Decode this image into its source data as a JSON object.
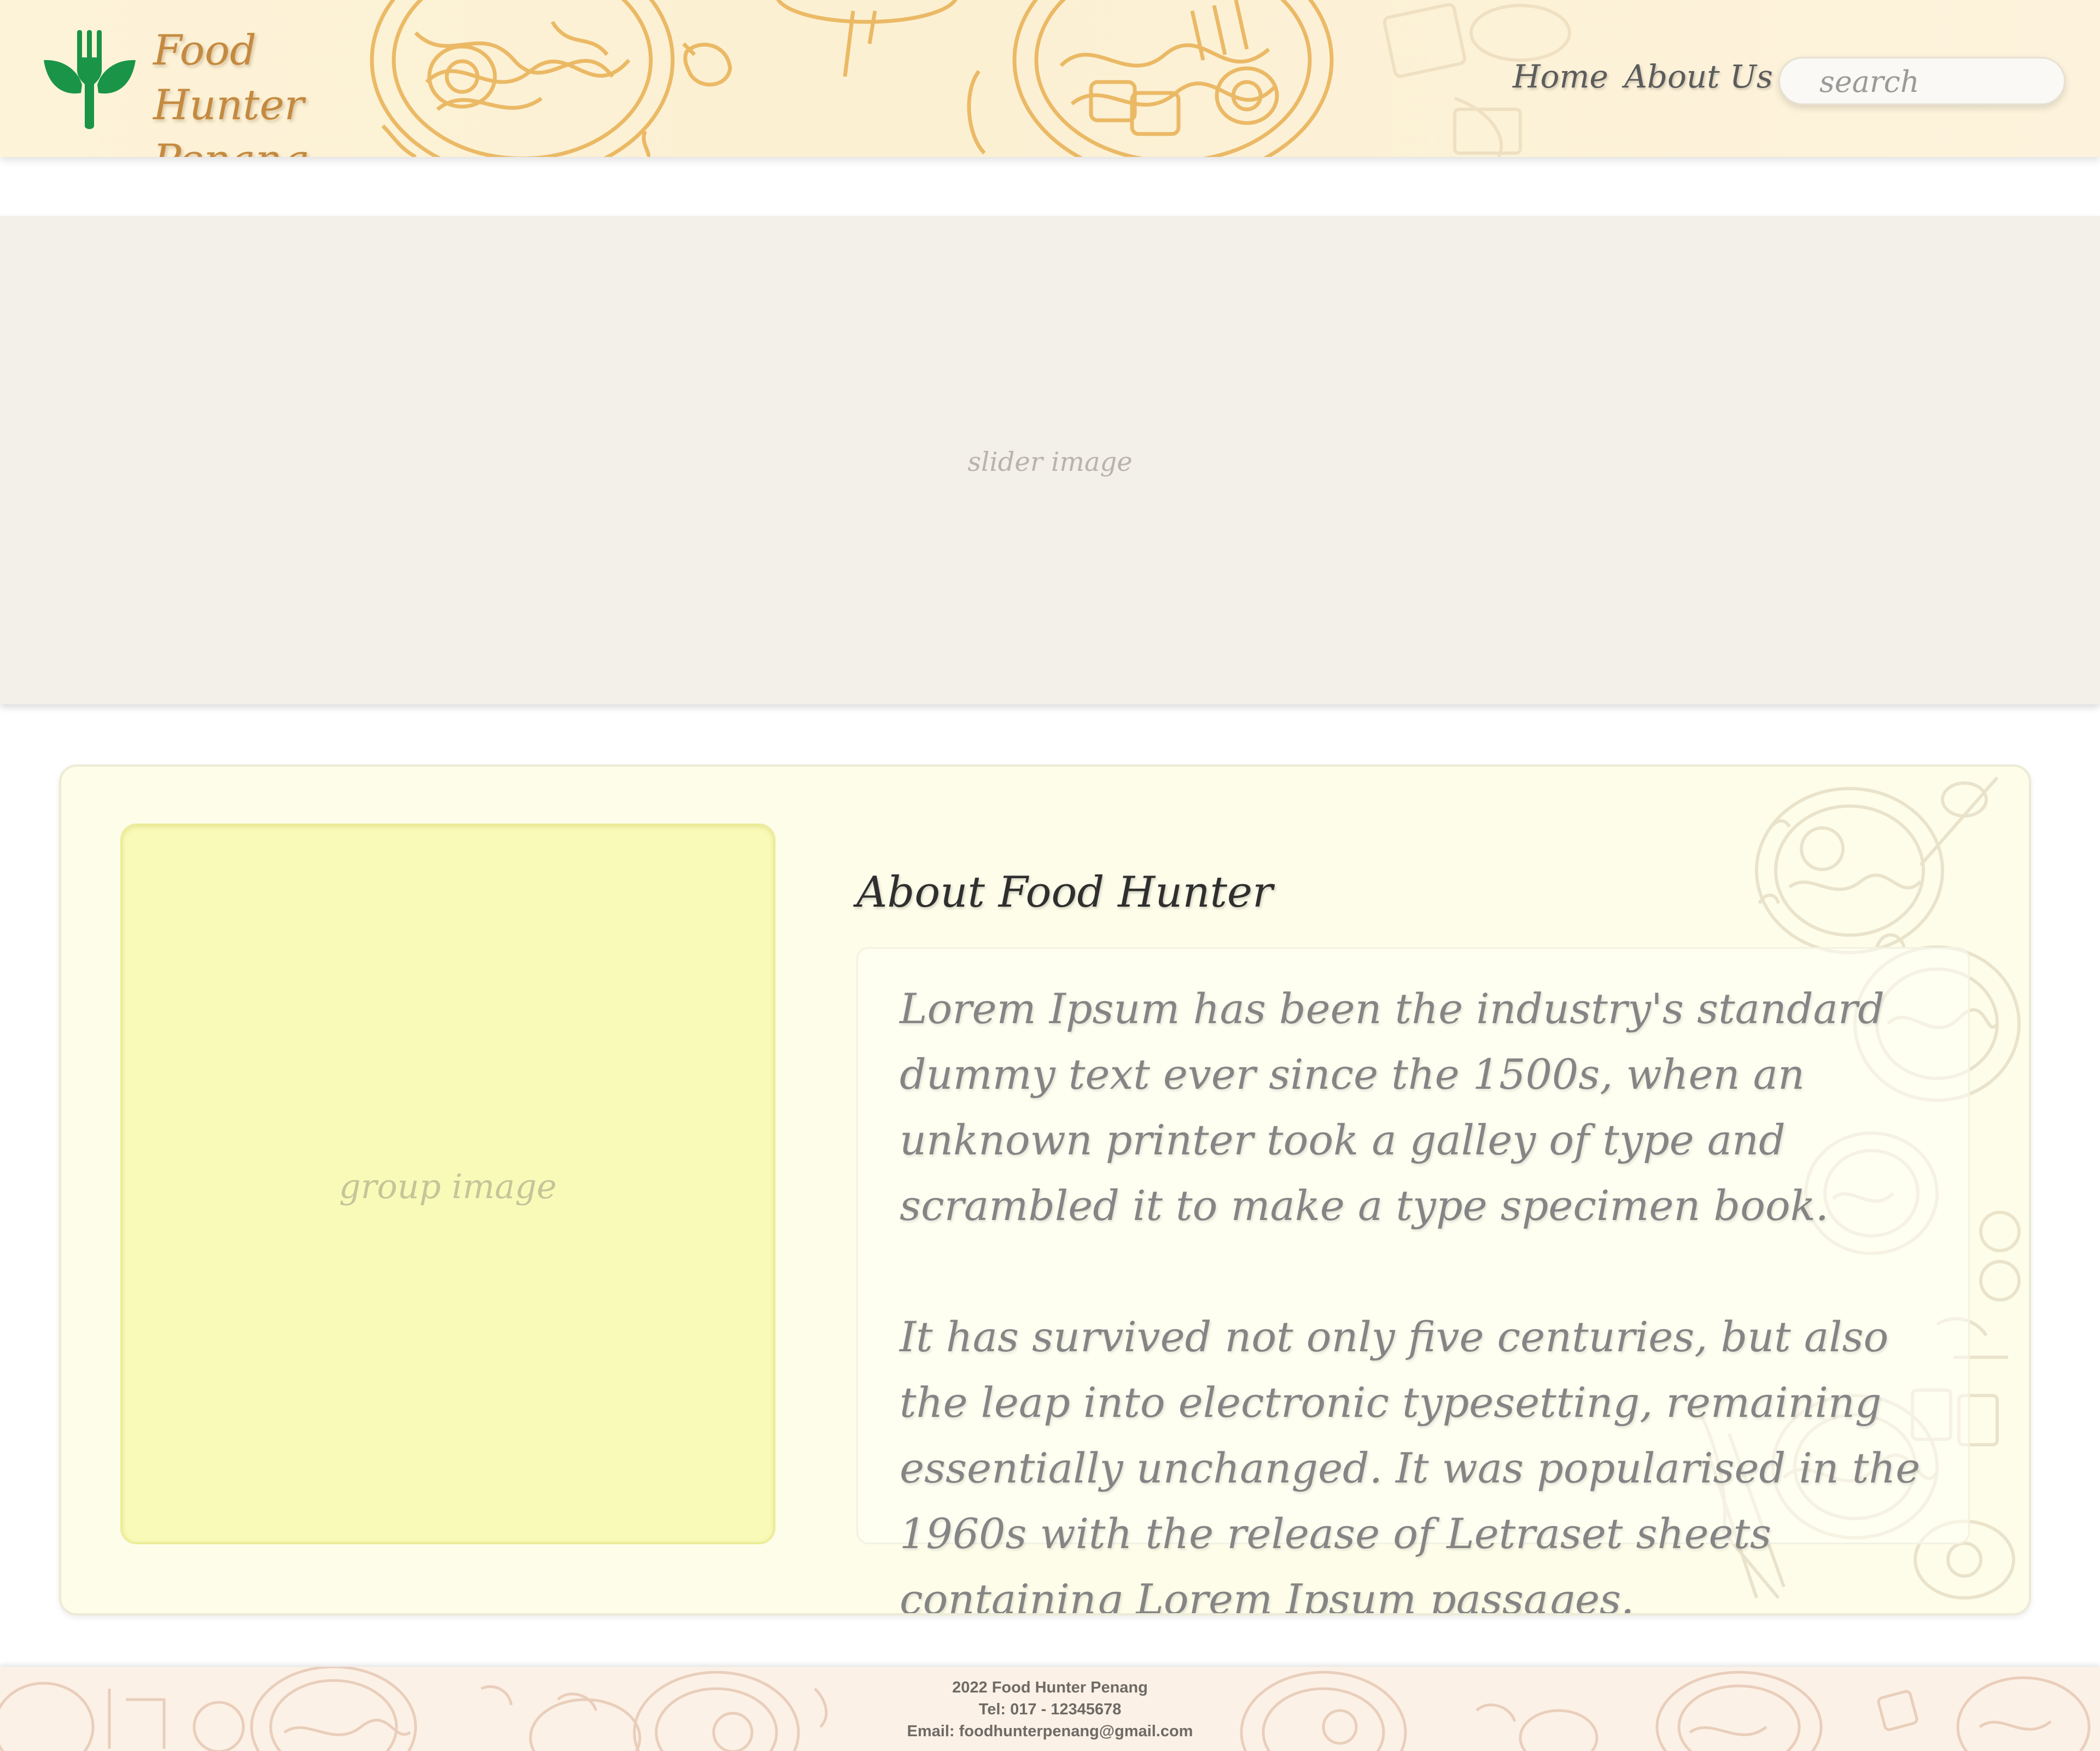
{
  "header": {
    "brand_line1": "Food Hunter",
    "brand_line2": "Penang",
    "logo_icon": "fork-leaf-icon",
    "nav": {
      "home": "Home",
      "about": "About Us"
    },
    "search": {
      "placeholder": "search",
      "value": ""
    }
  },
  "slider": {
    "label": "slider image"
  },
  "about": {
    "image_label": "group image",
    "title": "About Food Hunter",
    "paragraphs": [
      "Lorem Ipsum has been the industry's standard dummy text ever since the 1500s, when an unknown printer took a galley of type and scrambled it to make a type specimen book.",
      "It has survived not only five centuries, but also the leap into electronic typesetting, remaining essentially unchanged. It was popularised in the 1960s with the release of Letraset sheets containing Lorem Ipsum passages."
    ]
  },
  "footer": {
    "copyright": "2022 Food Hunter Penang",
    "tel": "Tel: 017 - 12345678",
    "email": "Email: foodhunterpenang@gmail.com"
  },
  "colors": {
    "header_bg": "#fdf3d9",
    "brand": "#c48a40",
    "logo_green": "#1a9447",
    "illustration_orange": "#eab45a",
    "slider_bg": "#f3efe9",
    "card_bg": "#fdfde9",
    "group_image_bg": "#fafab8",
    "footer_bg": "#fcf1e6"
  }
}
